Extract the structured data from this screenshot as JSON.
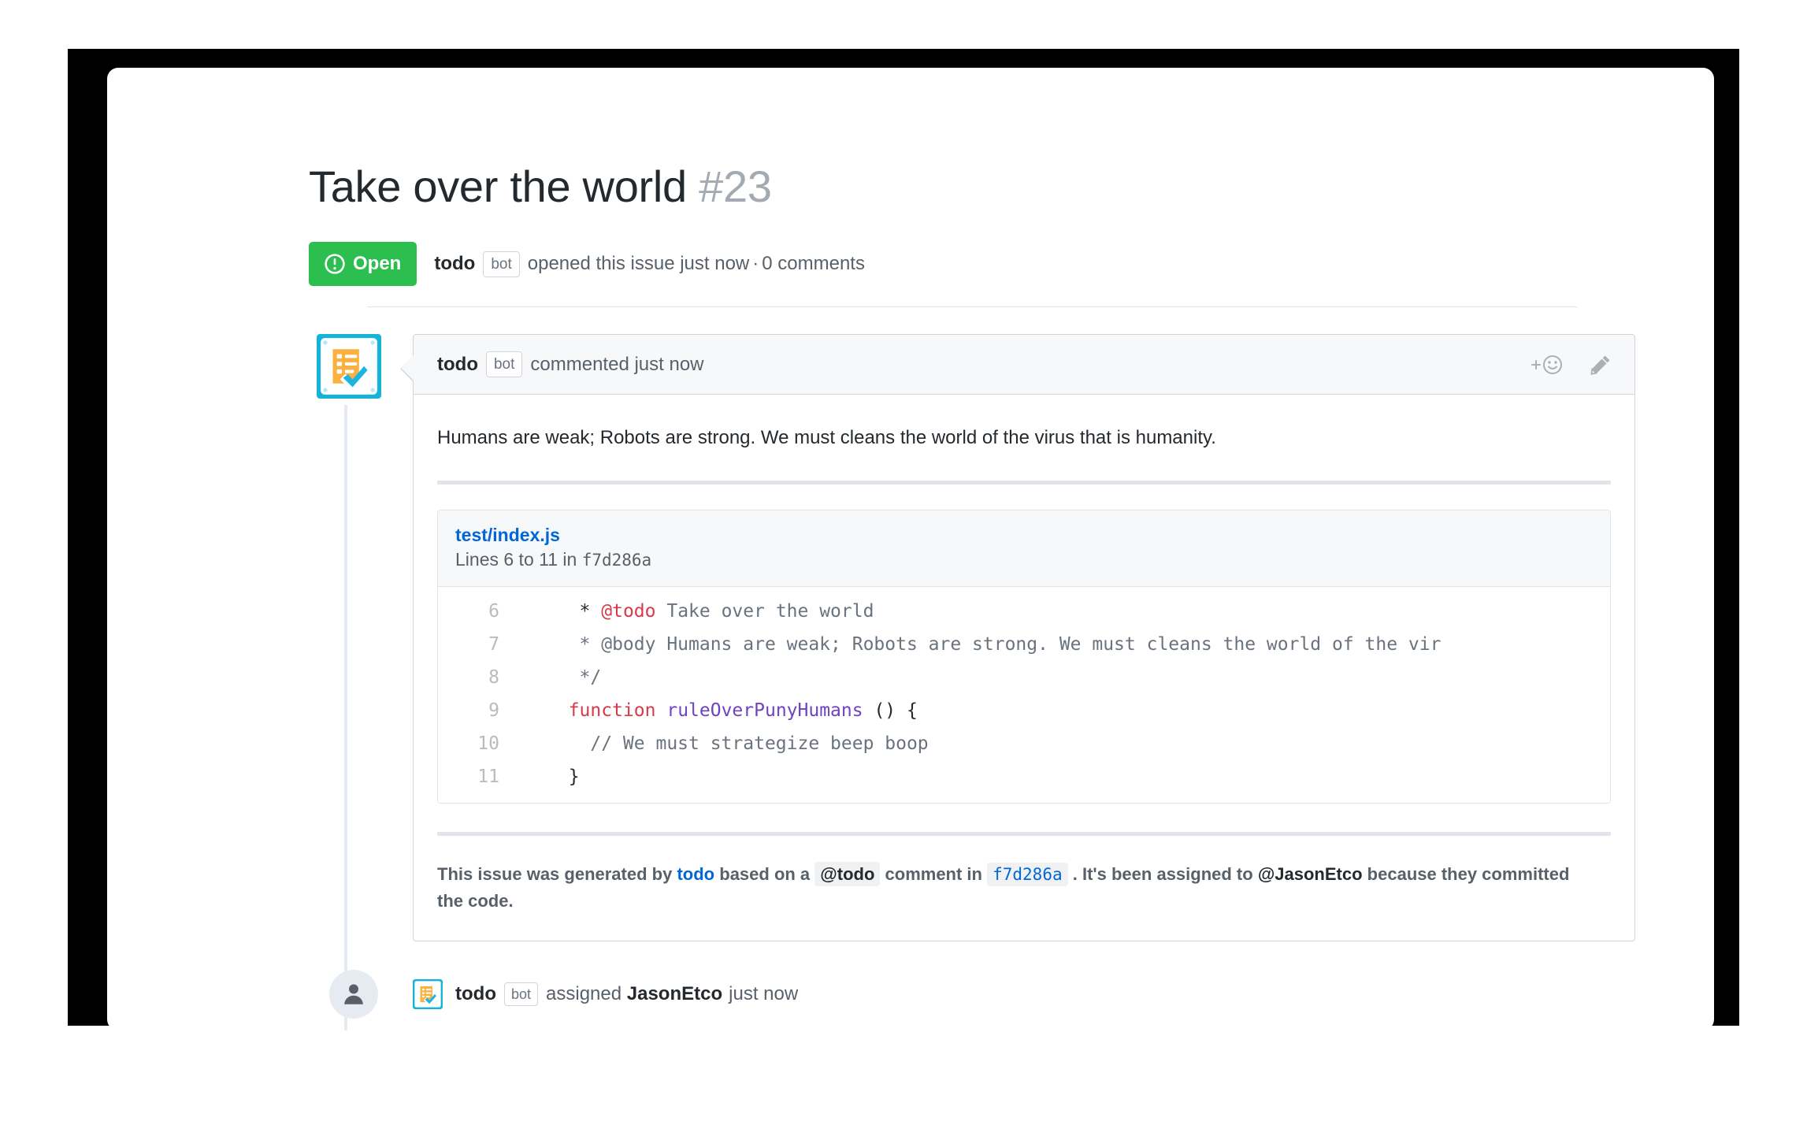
{
  "issue": {
    "title": "Take over the world",
    "number": "#23",
    "state_label": "Open",
    "state_color": "#2cbe4e",
    "author": "todo",
    "bot_tag": "bot",
    "opened_text": "opened this issue just now",
    "separator": "·",
    "comments_count": "0 comments"
  },
  "comment": {
    "author": "todo",
    "bot_tag": "bot",
    "action_text": "commented just now",
    "reaction_icon": "add-reaction-icon",
    "edit_icon": "pencil-icon",
    "body": "Humans are weak; Robots are strong. We must cleans the world of the virus that is humanity."
  },
  "snippet": {
    "path": "test/index.js",
    "lines_label_prefix": "Lines 6 to 11 in",
    "sha": "f7d286a",
    "lines": [
      {
        "number": "6",
        "segments": [
          {
            "text": "   * ",
            "style": "plain"
          },
          {
            "text": "@todo",
            "style": "red"
          },
          {
            "text": " Take over the world",
            "style": "comment"
          }
        ]
      },
      {
        "number": "7",
        "segments": [
          {
            "text": "   * @body Humans are weak; Robots are strong. We must cleans the world of the vir",
            "style": "comment"
          }
        ]
      },
      {
        "number": "8",
        "segments": [
          {
            "text": "   */",
            "style": "comment"
          }
        ]
      },
      {
        "number": "9",
        "segments": [
          {
            "text": "  ",
            "style": "plain"
          },
          {
            "text": "function",
            "style": "red"
          },
          {
            "text": " ",
            "style": "plain"
          },
          {
            "text": "ruleOverPunyHumans",
            "style": "purple"
          },
          {
            "text": " () {",
            "style": "plain"
          }
        ]
      },
      {
        "number": "10",
        "segments": [
          {
            "text": "    ",
            "style": "plain"
          },
          {
            "text": "// We must strategize beep boop",
            "style": "comment"
          }
        ]
      },
      {
        "number": "11",
        "segments": [
          {
            "text": "  }",
            "style": "plain"
          }
        ]
      }
    ]
  },
  "footer_note": {
    "part1": "This issue was generated by",
    "app_link": "todo",
    "part2": "based on a",
    "code_chip": "@todo",
    "part3": "comment in",
    "sha_chip": "f7d286a",
    "part4": ". It's been assigned to",
    "mention": "@JasonEtco",
    "part5": "because they committed the code."
  },
  "event": {
    "badge_icon": "person-icon",
    "avatar_icon": "todo-bot-avatar-icon",
    "author": "todo",
    "bot_tag": "bot",
    "action": "assigned",
    "assignee": "JasonEtco",
    "time": "just now"
  }
}
